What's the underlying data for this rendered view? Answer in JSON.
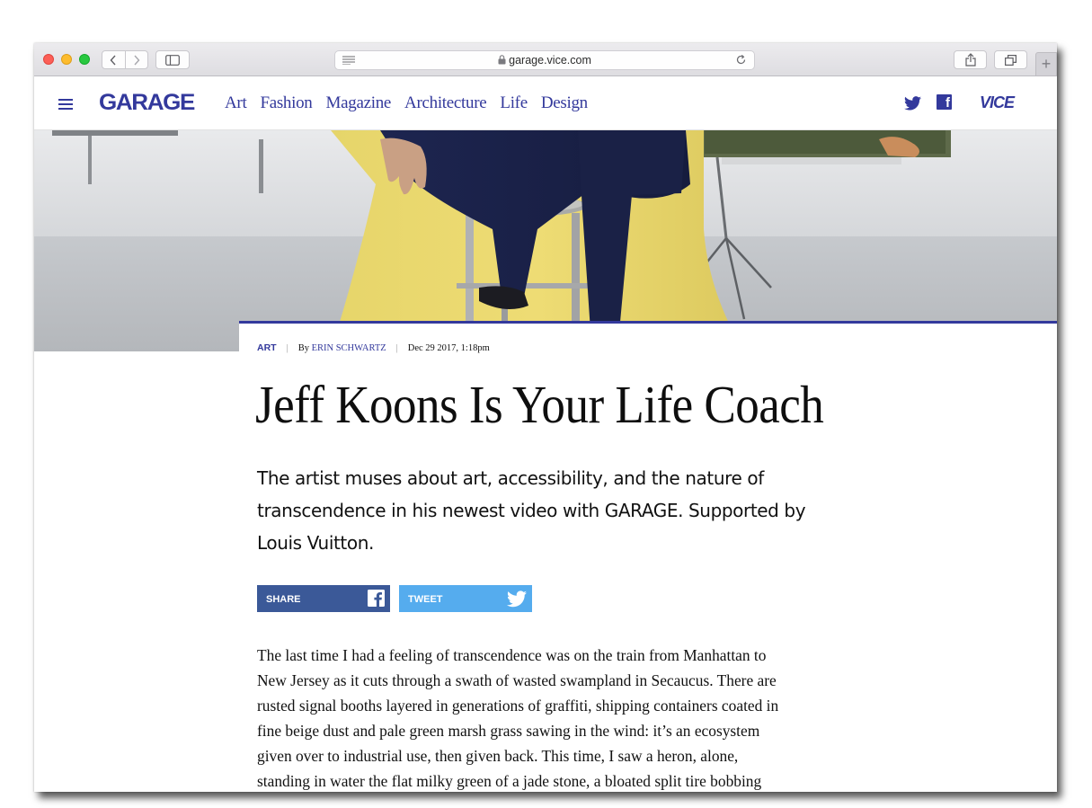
{
  "browser": {
    "url": "garage.vice.com",
    "plus_label": "+"
  },
  "site": {
    "logo": "GARAGE",
    "nav": [
      "Art",
      "Fashion",
      "Magazine",
      "Architecture",
      "Life",
      "Design"
    ],
    "vice_logo": "VICE",
    "accent_color": "#33399c"
  },
  "article": {
    "category": "ART",
    "byline_prefix": "By",
    "author": "ERIN SCHWARTZ",
    "date": "Dec 29 2017, 1:18pm",
    "title": "Jeff Koons Is Your Life Coach",
    "dek": "The artist muses about art, accessibility, and the nature of transcendence in his newest video with GARAGE. Supported by Louis Vuitton.",
    "share_label": "SHARE",
    "tweet_label": "TWEET",
    "body_lines": [
      "The last time I had a feeling of transcendence was on the train from Manhattan to",
      "New Jersey as it cuts through a swath of wasted swampland in Secaucus. There are",
      "rusted signal booths layered in generations of graffiti, shipping containers coated in",
      "fine beige dust and pale green marsh grass sawing in the wind: it’s an ecosystem",
      "given over to industrial use, then given back. This time, I saw a heron, alone,",
      "standing in water the flat milky green of a jade stone, a bloated split tire bobbing"
    ]
  }
}
